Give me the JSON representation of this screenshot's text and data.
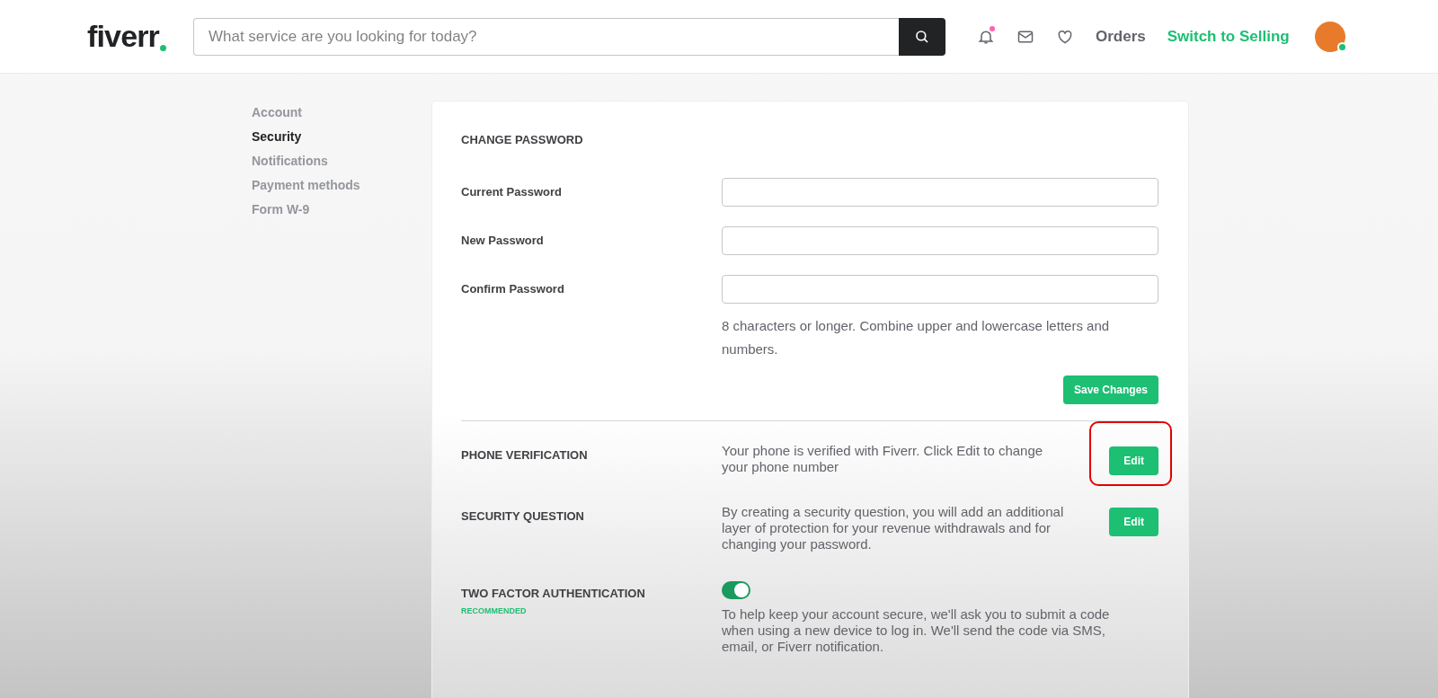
{
  "header": {
    "logo": "fiverr",
    "search": {
      "placeholder": "What service are you looking for today?"
    },
    "notifications_unread": true,
    "orders": "Orders",
    "switch": "Switch to Selling",
    "online": true
  },
  "sidebar": {
    "items": [
      {
        "label": "Account",
        "selected": false
      },
      {
        "label": "Security",
        "selected": true
      },
      {
        "label": "Notifications",
        "selected": false
      },
      {
        "label": "Payment methods",
        "selected": false
      },
      {
        "label": "Form W-9",
        "selected": false
      }
    ]
  },
  "change_password": {
    "title": "CHANGE PASSWORD",
    "fields": [
      {
        "label": "Current Password"
      },
      {
        "label": "New Password"
      },
      {
        "label": "Confirm Password"
      }
    ],
    "hint": "8 characters or longer. Combine upper and lowercase letters and numbers.",
    "save": "Save Changes"
  },
  "settings": [
    {
      "title": "PHONE VERIFICATION",
      "description": "Your phone is verified with Fiverr. Click Edit to change your phone number",
      "kind": "edit",
      "button": "Edit",
      "highlighted": true
    },
    {
      "title": "SECURITY QUESTION",
      "description": "By creating a security question, you will add an additional layer of protection for your revenue withdrawals and for changing your password.",
      "kind": "edit",
      "button": "Edit",
      "highlighted": false
    },
    {
      "title": "TWO FACTOR AUTHENTICATION",
      "badge": "RECOMMENDED",
      "description": "To help keep your account secure, we'll ask you to submit a code when using a new device to log in. We'll send the code via SMS, email, or Fiverr notification.",
      "kind": "toggle",
      "on": true
    }
  ]
}
